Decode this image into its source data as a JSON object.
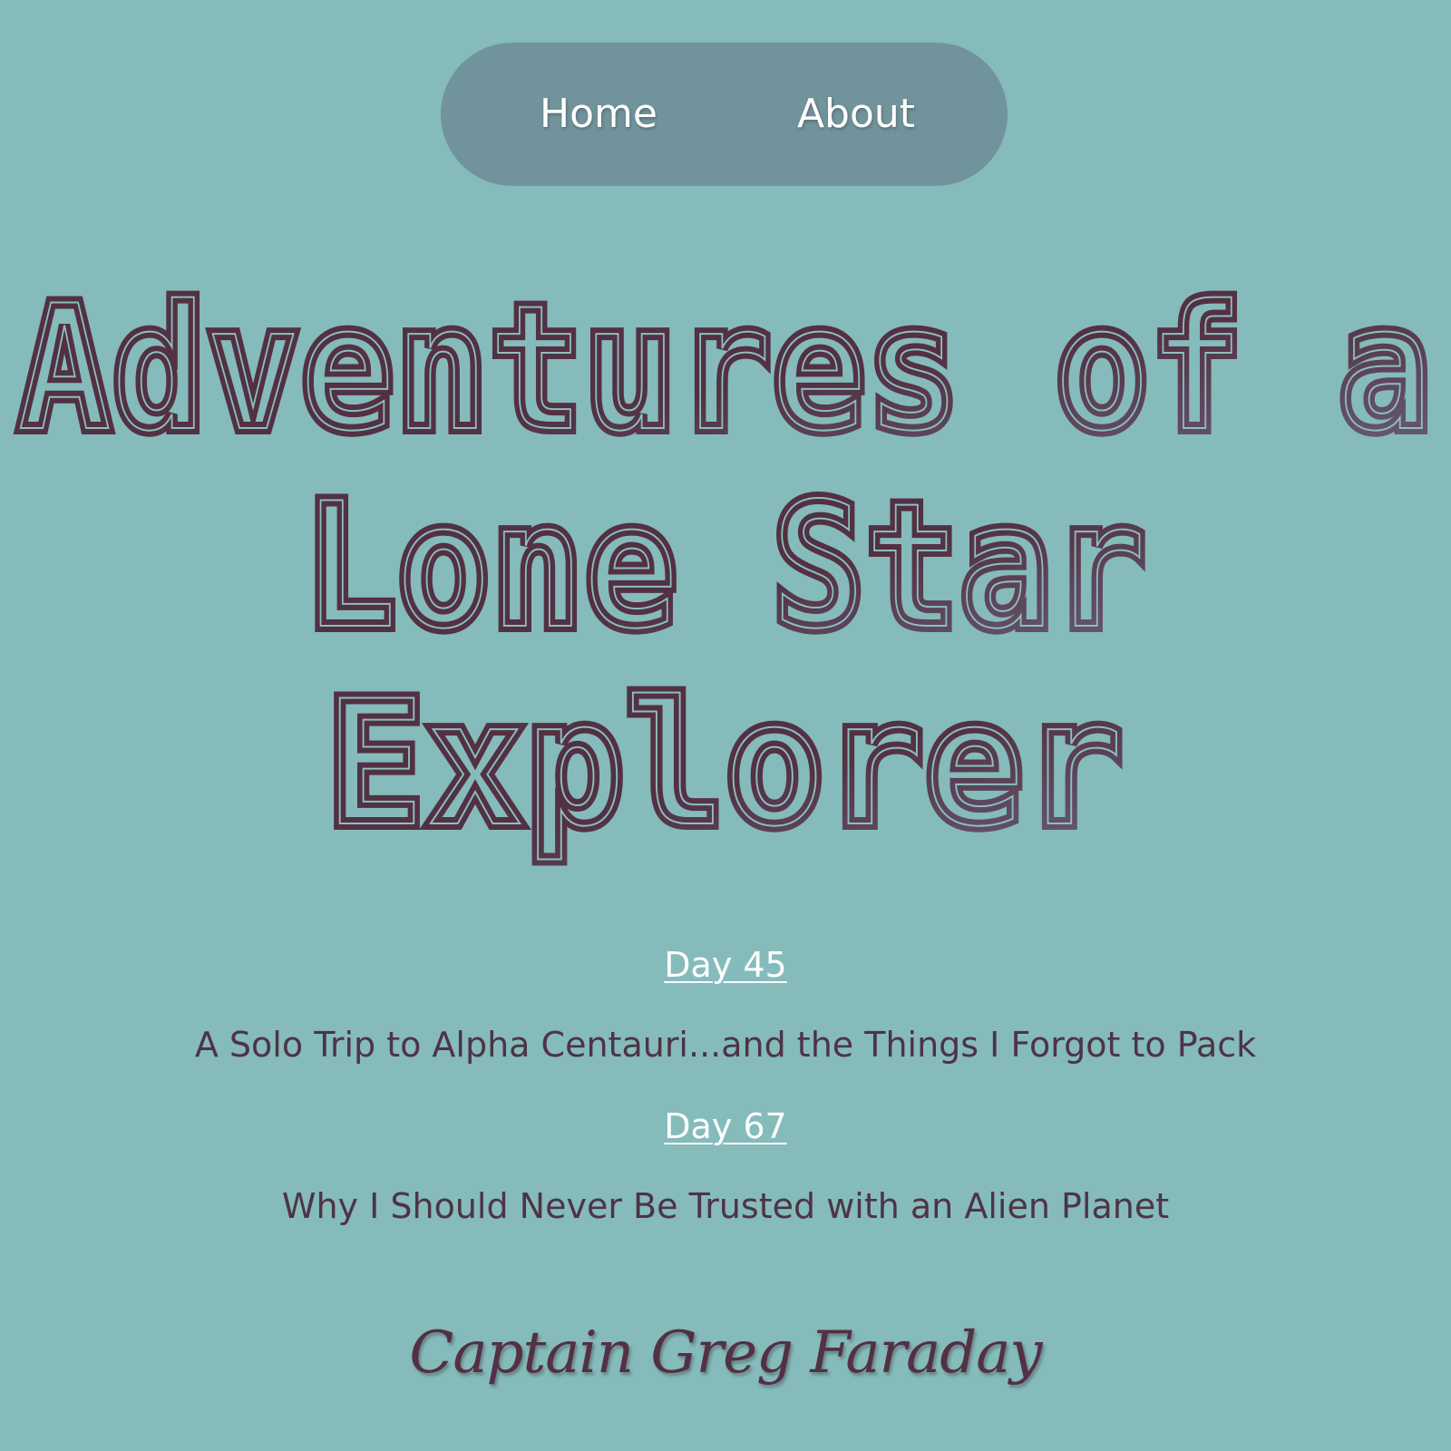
{
  "nav": {
    "items": [
      {
        "label": "Home"
      },
      {
        "label": "About"
      }
    ]
  },
  "hero": {
    "lines": [
      "Adventures of a",
      "Lone Star",
      "Explorer"
    ]
  },
  "posts": [
    {
      "date": "Day 45",
      "title": "A Solo Trip to Alpha Centauri...and the Things I Forgot to Pack"
    },
    {
      "date": "Day 67",
      "title": "Why I Should Never Be Trusted with an Alien Planet"
    }
  ],
  "footer": {
    "signature": "Captain Greg Faraday"
  },
  "colors": {
    "background": "#85bbbb",
    "nav_pill": "#71939b",
    "title_dark": "#533043",
    "title_light": "#685a73",
    "text": "#4e3346",
    "link": "#ffffff"
  }
}
